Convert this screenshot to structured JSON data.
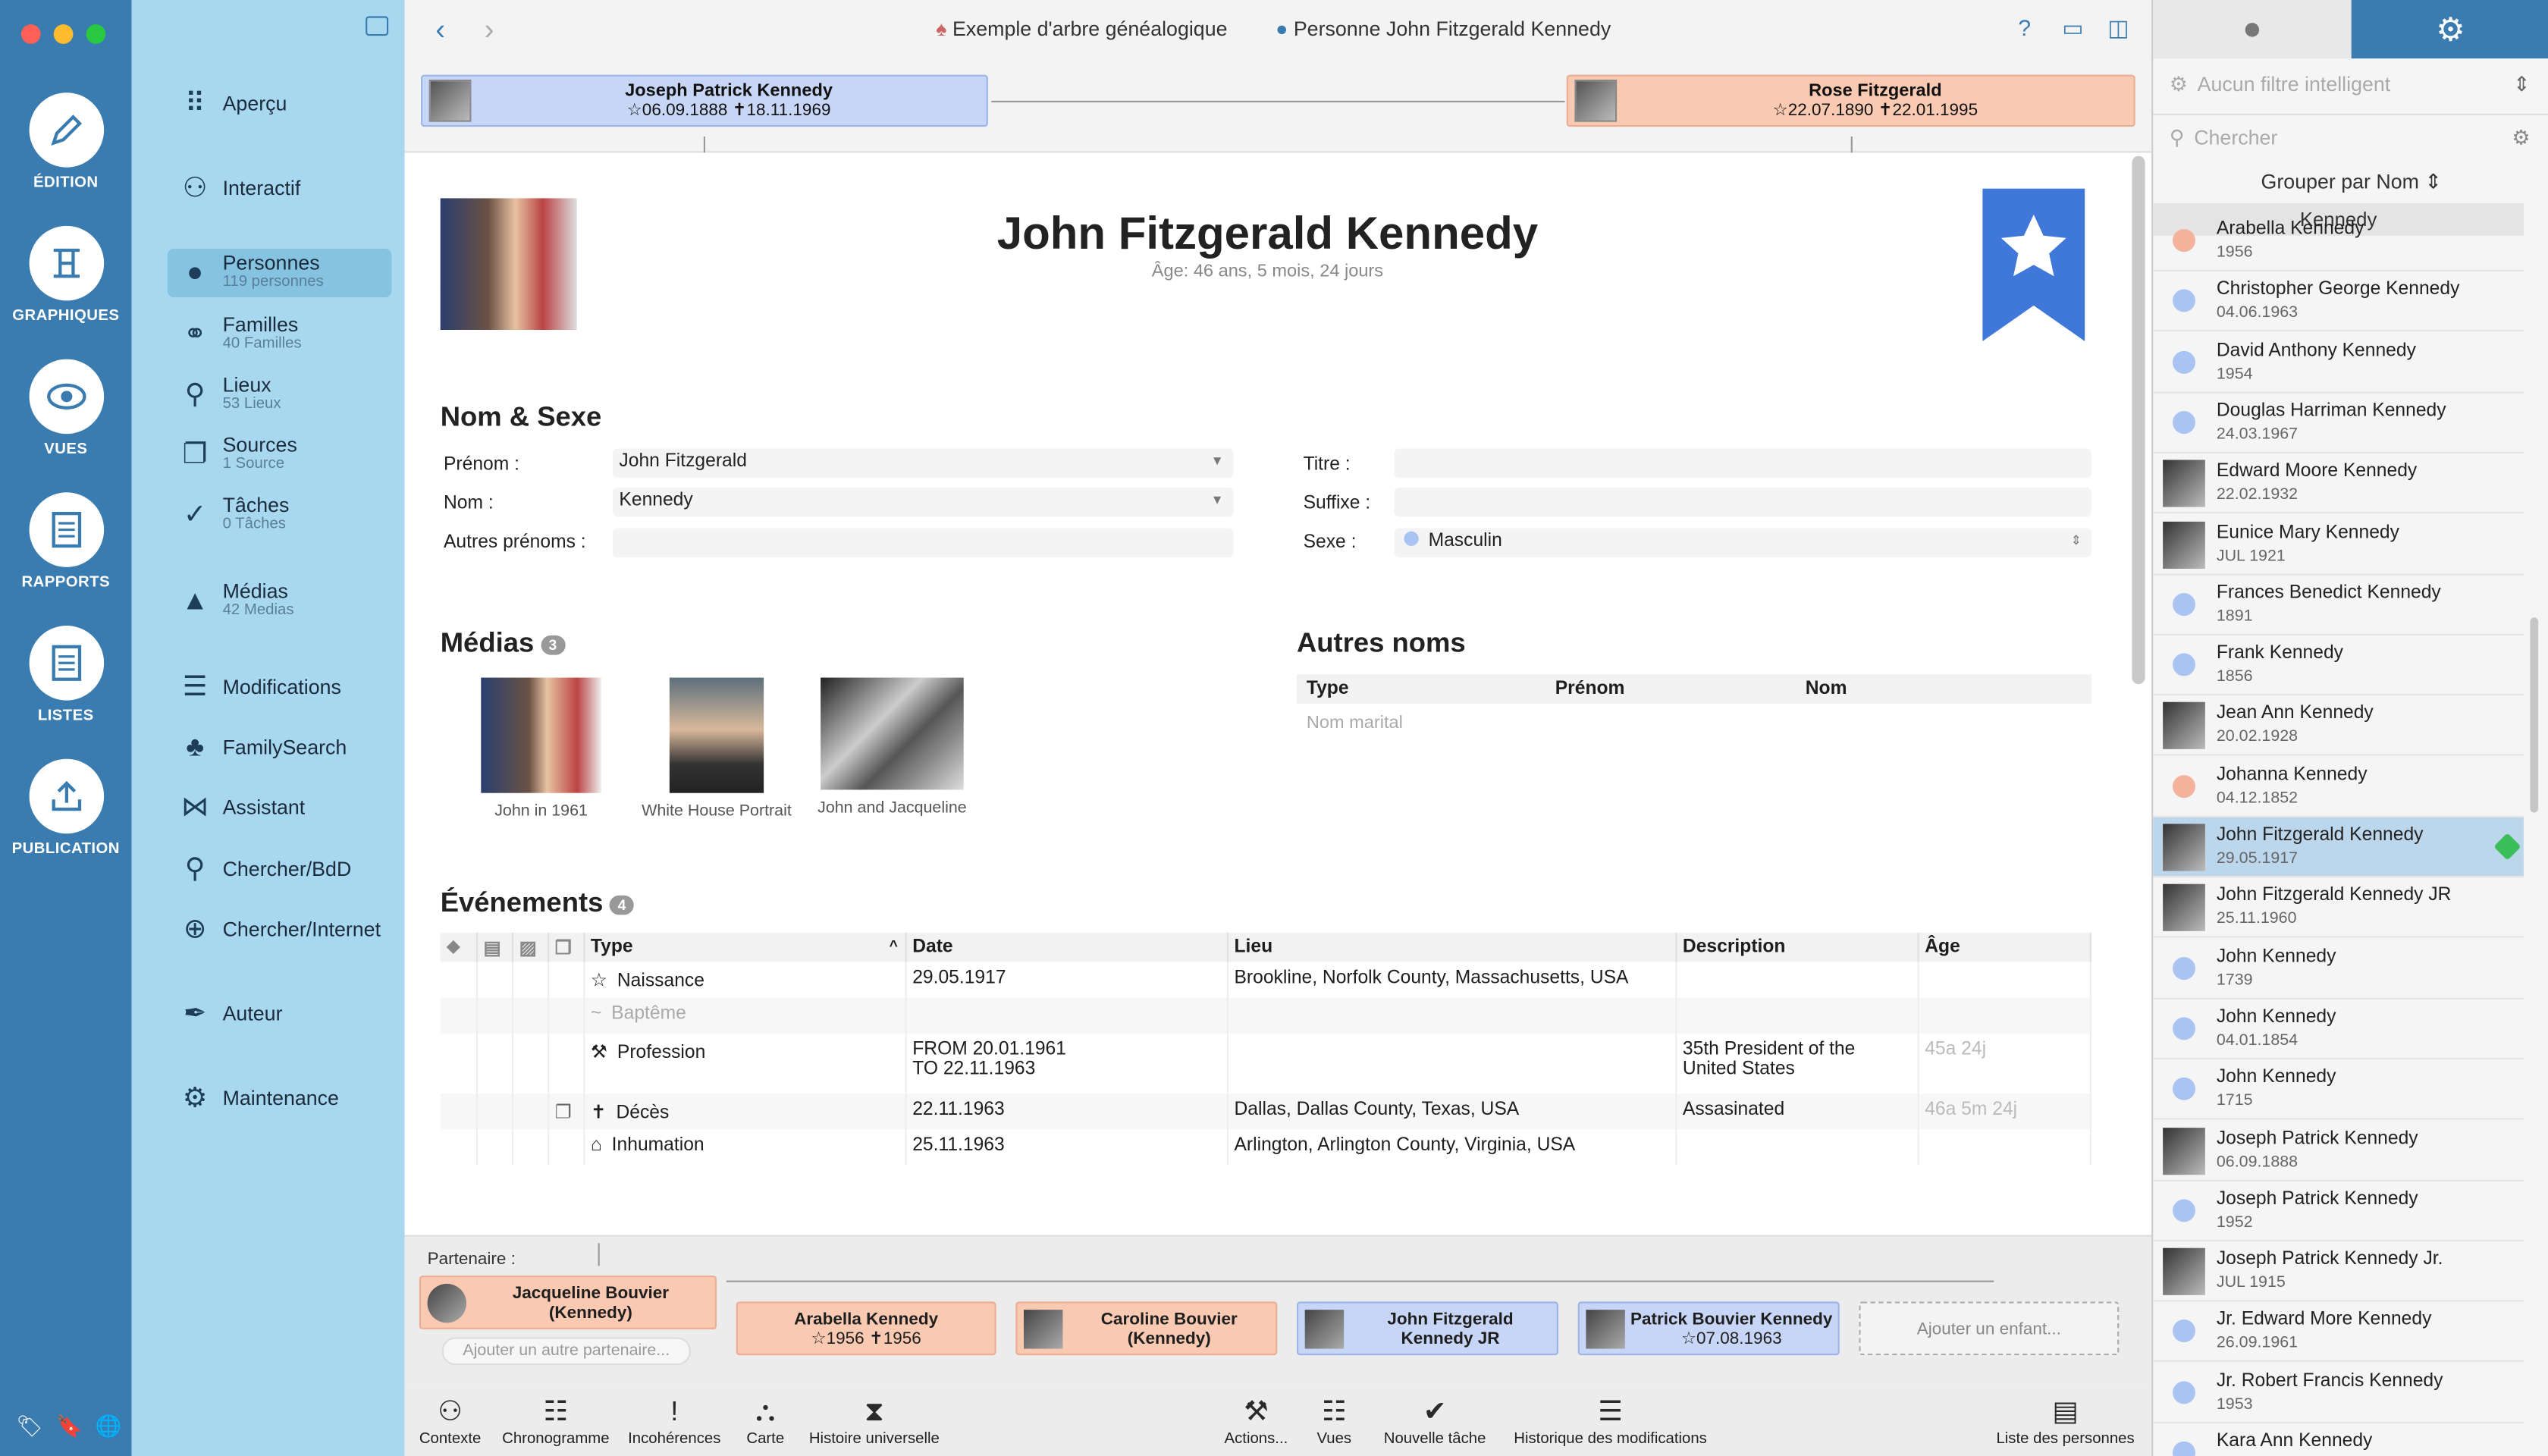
{
  "rail": {
    "items": [
      {
        "label": "ÉDITION",
        "icon": "pencil-icon"
      },
      {
        "label": "GRAPHIQUES",
        "icon": "chart-tree-icon"
      },
      {
        "label": "VUES",
        "icon": "eye-icon"
      },
      {
        "label": "RAPPORTS",
        "icon": "report-icon"
      },
      {
        "label": "LISTES",
        "icon": "list-icon"
      },
      {
        "label": "PUBLICATION",
        "icon": "upload-icon"
      }
    ]
  },
  "sidebar": {
    "items": [
      {
        "label": "Aperçu",
        "sub": "",
        "icon": "grid-icon"
      },
      {
        "label": "Interactif",
        "sub": "",
        "icon": "tree-icon"
      },
      {
        "label": "Personnes",
        "sub": "119 personnes",
        "icon": "person-icon"
      },
      {
        "label": "Familles",
        "sub": "40 Familles",
        "icon": "rings-icon"
      },
      {
        "label": "Lieux",
        "sub": "53 Lieux",
        "icon": "pin-icon"
      },
      {
        "label": "Sources",
        "sub": "1 Source",
        "icon": "sources-icon"
      },
      {
        "label": "Tâches",
        "sub": "0 Tâches",
        "icon": "check-icon"
      },
      {
        "label": "Médias",
        "sub": "42 Medias",
        "icon": "media-icon"
      },
      {
        "label": "Modifications",
        "sub": "",
        "icon": "list-icon"
      },
      {
        "label": "FamilySearch",
        "sub": "",
        "icon": "familysearch-icon"
      },
      {
        "label": "Assistant",
        "sub": "",
        "icon": "assistant-icon"
      },
      {
        "label": "Chercher/BdD",
        "sub": "",
        "icon": "search-icon"
      },
      {
        "label": "Chercher/Internet",
        "sub": "",
        "icon": "globe-search-icon"
      },
      {
        "label": "Auteur",
        "sub": "",
        "icon": "pen-icon"
      },
      {
        "label": "Maintenance",
        "sub": "",
        "icon": "maintenance-icon"
      }
    ]
  },
  "toolbar": {
    "tree_name": "Exemple d'arbre généalogique",
    "person_crumb": "Personne John Fitzgerald Kennedy",
    "help": "?"
  },
  "parents": {
    "father": {
      "name": "Joseph Patrick Kennedy",
      "dates": "☆06.09.1888 ✝18.11.1969"
    },
    "mother": {
      "name": "Rose Fitzgerald",
      "dates": "☆22.07.1890 ✝22.01.1995"
    }
  },
  "person": {
    "name": "John Fitzgerald Kennedy",
    "age": "Âge: 46 ans, 5 mois, 24 jours"
  },
  "name_section": {
    "title": "Nom & Sexe",
    "labels": {
      "first": "Prénom :",
      "last": "Nom :",
      "other": "Autres prénoms :",
      "title": "Titre :",
      "suffix": "Suffixe :",
      "sex": "Sexe :"
    },
    "values": {
      "first": "John Fitzgerald",
      "last": "Kennedy",
      "other": "",
      "title": "",
      "suffix": "",
      "sex": "Masculin"
    }
  },
  "media_section": {
    "title": "Médias",
    "count": "3",
    "items": [
      {
        "caption": "John in 1961"
      },
      {
        "caption": "White House Portrait"
      },
      {
        "caption": "John and Jacqueline"
      }
    ]
  },
  "other_names": {
    "title": "Autres noms",
    "headers": [
      "Type",
      "Prénom",
      "Nom"
    ],
    "placeholder": "Nom marital"
  },
  "events": {
    "title": "Événements",
    "count": "4",
    "headers": {
      "type": "Type",
      "date": "Date",
      "place": "Lieu",
      "desc": "Description",
      "age": "Âge"
    },
    "rows": [
      {
        "icon": "star-icon",
        "type": "Naissance",
        "date": "29.05.1917",
        "date2": "",
        "place": "Brookline, Norfolk County, Massachusetts, USA",
        "desc": "",
        "desc2": "",
        "age": ""
      },
      {
        "icon": "tilde-icon",
        "type": "Baptême",
        "date": "",
        "date2": "",
        "place": "",
        "desc": "",
        "desc2": "",
        "age": ""
      },
      {
        "icon": "hammer-icon",
        "type": "Profession",
        "date": "FROM 20.01.1961",
        "date2": "TO 22.11.1963",
        "place": "",
        "desc": "35th President of the",
        "desc2": "United States",
        "age": "45a 24j"
      },
      {
        "icon": "cross-icon",
        "type": "Décès",
        "date": "22.11.1963",
        "date2": "",
        "place": "Dallas, Dallas County, Texas, USA",
        "desc": "Assasinated",
        "desc2": "",
        "age": "46a 5m 24j"
      },
      {
        "icon": "tomb-icon",
        "type": "Inhumation",
        "date": "25.11.1963",
        "date2": "",
        "place": "Arlington, Arlington County, Virginia, USA",
        "desc": "",
        "desc2": "",
        "age": ""
      }
    ]
  },
  "family": {
    "partner_label": "Partenaire :",
    "partner": {
      "name": "Jacqueline Bouvier",
      "name2": "(Kennedy)"
    },
    "add_partner": "Ajouter un autre partenaire...",
    "children": [
      {
        "name": "Arabella Kennedy",
        "name2": "☆1956 ✝1956"
      },
      {
        "name": "Caroline Bouvier",
        "name2": "(Kennedy)"
      },
      {
        "name": "John Fitzgerald",
        "name2": "Kennedy JR"
      },
      {
        "name": "Patrick Bouvier Kennedy",
        "name2": "☆07.08.1963"
      }
    ],
    "add_child": "Ajouter un enfant..."
  },
  "bottom": {
    "left": [
      {
        "label": "Contexte",
        "icon": "context-icon"
      },
      {
        "label": "Chronogramme",
        "icon": "timeline-icon"
      },
      {
        "label": "Incohérences",
        "icon": "exclamation-icon"
      },
      {
        "label": "Carte",
        "icon": "map-icon"
      },
      {
        "label": "Histoire universelle",
        "icon": "hourglass-icon"
      }
    ],
    "right": [
      {
        "label": "Actions...",
        "icon": "hammer-icon"
      },
      {
        "label": "Vues",
        "icon": "views-icon"
      },
      {
        "label": "Nouvelle tâche",
        "icon": "checkmark-icon"
      },
      {
        "label": "Historique des modifications",
        "icon": "history-icon"
      },
      {
        "label": "Liste des personnes",
        "icon": "list-icon"
      }
    ]
  },
  "right_panel": {
    "filter": "Aucun filtre intelligent",
    "search_placeholder": "Chercher",
    "group_by": "Grouper par Nom ⇕",
    "group_header": "Kennedy",
    "people": [
      {
        "name": "Arabella Kennedy",
        "date": "1956",
        "kind": "female"
      },
      {
        "name": "Christopher George Kennedy",
        "date": "04.06.1963",
        "kind": "male"
      },
      {
        "name": "David Anthony Kennedy",
        "date": "1954",
        "kind": "male"
      },
      {
        "name": "Douglas Harriman Kennedy",
        "date": "24.03.1967",
        "kind": "male"
      },
      {
        "name": "Edward Moore Kennedy",
        "date": "22.02.1932",
        "kind": "photo"
      },
      {
        "name": "Eunice Mary Kennedy",
        "date": "JUL 1921",
        "kind": "photo"
      },
      {
        "name": "Frances Benedict Kennedy",
        "date": "1891",
        "kind": "male"
      },
      {
        "name": "Frank Kennedy",
        "date": "1856",
        "kind": "male"
      },
      {
        "name": "Jean Ann Kennedy",
        "date": "20.02.1928",
        "kind": "photo"
      },
      {
        "name": "Johanna Kennedy",
        "date": "04.12.1852",
        "kind": "female"
      },
      {
        "name": "John Fitzgerald Kennedy",
        "date": "29.05.1917",
        "kind": "photo"
      },
      {
        "name": "John Fitzgerald Kennedy JR",
        "date": "25.11.1960",
        "kind": "photo"
      },
      {
        "name": "John Kennedy",
        "date": "1739",
        "kind": "male"
      },
      {
        "name": "John Kennedy",
        "date": "04.01.1854",
        "kind": "male"
      },
      {
        "name": "John Kennedy",
        "date": "1715",
        "kind": "male"
      },
      {
        "name": "Joseph Patrick Kennedy",
        "date": "06.09.1888",
        "kind": "photo"
      },
      {
        "name": "Joseph Patrick Kennedy",
        "date": "1952",
        "kind": "male"
      },
      {
        "name": "Joseph Patrick Kennedy Jr.",
        "date": "JUL 1915",
        "kind": "photo"
      },
      {
        "name": "Jr. Edward More Kennedy",
        "date": "26.09.1961",
        "kind": "male"
      },
      {
        "name": "Jr. Robert Francis Kennedy",
        "date": "1953",
        "kind": "male"
      },
      {
        "name": "Kara Ann Kennedy",
        "date": "",
        "kind": "male"
      }
    ]
  },
  "colors": {
    "rail": "#3a7cb0",
    "sidebar": "#a8d8ef",
    "male": "#c7d6f7",
    "female": "#f9c9b2",
    "male_dot": "#a9c3f2",
    "female_dot": "#f4b29a"
  }
}
